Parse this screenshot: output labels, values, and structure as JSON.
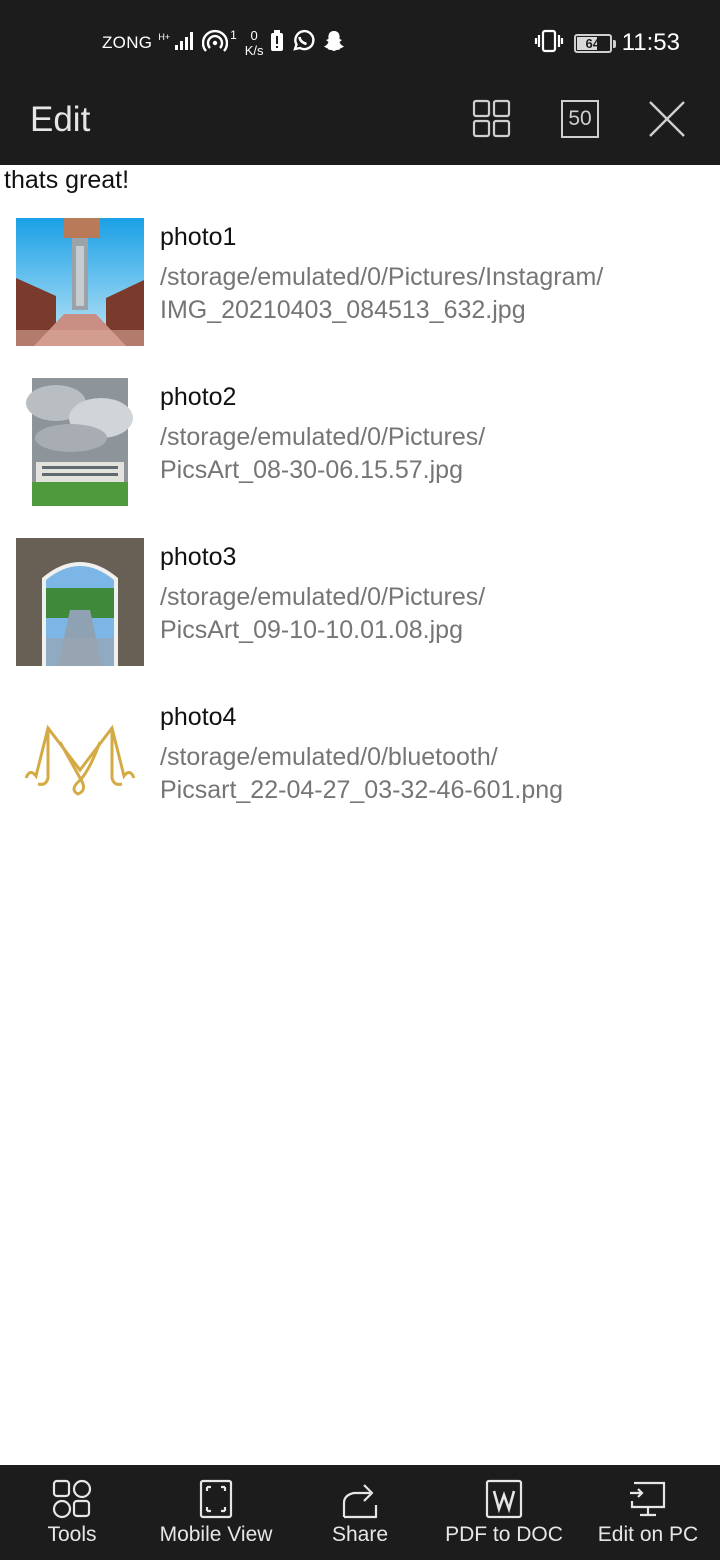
{
  "status_bar": {
    "carrier": "ZONG",
    "network_type": "H+",
    "hotspot_clients": "1",
    "speed_value": "0",
    "speed_unit": "K/s",
    "battery": "64",
    "time": "11:53"
  },
  "toolbar": {
    "title": "Edit",
    "zoom_label": "50"
  },
  "message": "thats great!",
  "photos": [
    {
      "name": "photo1",
      "path_line1": "/storage/emulated/0/Pictures/Instagram/",
      "path_line2": "IMG_20210403_084513_632.jpg"
    },
    {
      "name": "photo2",
      "path_line1": "/storage/emulated/0/Pictures/",
      "path_line2": "PicsArt_08-30-06.15.57.jpg"
    },
    {
      "name": "photo3",
      "path_line1": "/storage/emulated/0/Pictures/",
      "path_line2": "PicsArt_09-10-10.01.08.jpg"
    },
    {
      "name": "photo4",
      "path_line1": "/storage/emulated/0/bluetooth/",
      "path_line2": "Picsart_22-04-27_03-32-46-601.png"
    }
  ],
  "bottom_bar": {
    "tools": "Tools",
    "mobile_view": "Mobile View",
    "share": "Share",
    "pdf_to_doc": "PDF to DOC",
    "edit_on_pc": "Edit on PC"
  },
  "icons": {
    "signal": "signal-icon",
    "hotspot": "hotspot-icon",
    "battery_alert": "battery-saver-icon",
    "whatsapp": "whatsapp-icon",
    "snapchat": "snapchat-icon",
    "vibrate": "vibrate-icon",
    "grid": "grid-view-icon",
    "close": "close-icon",
    "tools": "tools-icon",
    "mobile_view": "mobile-view-icon",
    "share": "share-icon",
    "word": "word-doc-icon",
    "pc": "pc-monitor-icon"
  },
  "colors": {
    "bar_background": "#1c1c1c",
    "bar_foreground": "#e6e6e6",
    "path_text": "#757575",
    "title_text": "#111111"
  }
}
